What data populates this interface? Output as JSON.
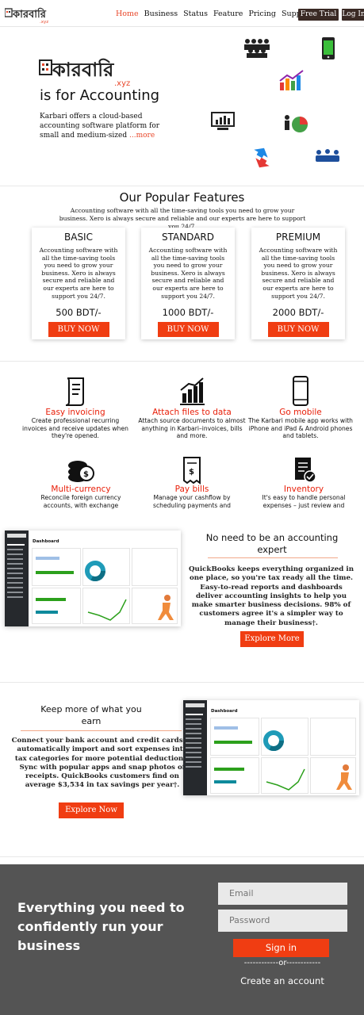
{
  "nav": {
    "logo_text": "কারবারি",
    "logo_sub": ".xyz",
    "links": [
      "Home",
      "Business",
      "Status",
      "Feature",
      "Pricing",
      "Support"
    ],
    "free_trial": "Free Trial",
    "login": "Log In"
  },
  "hero": {
    "logo_text": "কারবারি",
    "logo_sub": ".xyz",
    "title": "is for Accounting",
    "text": "Karbari offers a cloud-based accounting software platform for small and medium-sized",
    "more": "...more"
  },
  "features_head": {
    "title": "Our Popular Features",
    "subtitle": "Accounting software with all the time-saving tools you need to grow your business. Xero is always secure and reliable and our experts are here to support you 24/7."
  },
  "plans": [
    {
      "name": "BASIC",
      "desc": "Accounting software with all the time-saving tools you need to grow your business. Xero is always secure and reliable and our experts are here to support you 24/7.",
      "price": "500 BDT/-",
      "button": "BUY NOW"
    },
    {
      "name": "STANDARD",
      "desc": "Accounting software with all the time-saving tools you need to grow your business. Xero is always secure and reliable and our experts are here to support you 24/7.",
      "price": "1000 BDT/-",
      "button": "BUY NOW"
    },
    {
      "name": "PREMIUM",
      "desc": "Accounting software with all the time-saving tools you need to grow your business. Xero is always secure and reliable and our experts are here to support you 24/7.",
      "price": "2000 BDT/-",
      "button": "BUY NOW"
    }
  ],
  "features": [
    {
      "icon": "invoice-icon",
      "title": "Easy invoicing",
      "desc": "Create professional recurring invoices and receive updates when they're opened."
    },
    {
      "icon": "chart-icon",
      "title": "Attach files to data",
      "desc": "Attach source documents to almost anything in Karbari–invoices, bills and more."
    },
    {
      "icon": "mobile-icon",
      "title": "Go mobile",
      "desc": "The Karbari mobile app works with iPhone and iPad & Android phones and tablets."
    },
    {
      "icon": "currency-icon",
      "title": "Multi-currency",
      "desc": "Reconcile foreign currency accounts, with exchange"
    },
    {
      "icon": "bill-icon",
      "title": "Pay bills",
      "desc": "Manage your cashflow by scheduling payments and"
    },
    {
      "icon": "inventory-icon",
      "title": "Inventory",
      "desc": "It's easy to handle personal expenses – just review and"
    }
  ],
  "expert": {
    "title": "No need to be an accounting expert",
    "text": "QuickBooks keeps everything organized in one place, so you're tax ready all the time. Easy-to-read reports and dashboards deliver accounting insights to help you make smarter business decisions. 98% of customers agree it's a simpler way to manage their business†.",
    "button": "Explore More"
  },
  "earn": {
    "title": "Keep more of what you earn",
    "text": "Connect your bank account and credit cards to automatically import and sort expenses into tax categories for more potential deductions. Sync with popular apps and snap photos of receipts. QuickBooks customers find on average $3,534 in tax savings per year†.",
    "button": "Explore Now"
  },
  "dashboard": {
    "brand": "quickbooks",
    "title": "Dashboard"
  },
  "footer": {
    "headline": "Everything you need to confidently run your business",
    "email_placeholder": "Email",
    "password_placeholder": "Password",
    "signin": "Sign in",
    "or": "------------or------------",
    "create": "Create an account"
  },
  "colors": {
    "accent": "#f03d12",
    "dark_button": "#3a2a25",
    "footer_bg": "#545454"
  }
}
